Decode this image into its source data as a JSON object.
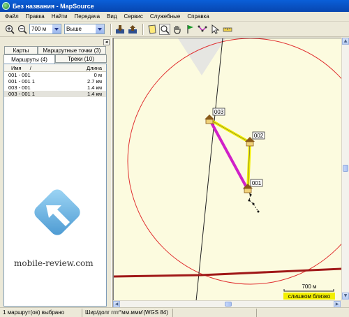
{
  "window": {
    "title": "Без названия - MapSource"
  },
  "menu": [
    "Файл",
    "Правка",
    "Найти",
    "Передача",
    "Вид",
    "Сервис",
    "Служебные",
    "Справка"
  ],
  "toolbar": {
    "zoom_value": "700 м",
    "detail_value": "Выше"
  },
  "left_panel": {
    "tabs_top": [
      "Карты",
      "Маршрутные точки (3)"
    ],
    "tabs_bottom": [
      "Маршруты (4)",
      "Треки (10)"
    ],
    "active_tab": "Маршруты (4)",
    "columns": {
      "name": "Имя",
      "length": "Длина",
      "sort_marker": "/"
    },
    "rows": [
      {
        "name": "001 - 001",
        "length": "0 м"
      },
      {
        "name": "001 - 001 1",
        "length": "2.7 км"
      },
      {
        "name": "003 - 001",
        "length": "1.4 км"
      },
      {
        "name": "003 - 001 1",
        "length": "1.4 км"
      }
    ],
    "selected_row": 3,
    "watermark": "mobile-review.com"
  },
  "map": {
    "waypoints": [
      "003",
      "002",
      "001"
    ],
    "scale_label": "700 м",
    "zoom_warning": "слишком близко",
    "colors": {
      "background": "#fcfbdf",
      "circle": "#e03030",
      "route_yellow": "#f2ee00",
      "route_magenta": "#d020c8",
      "road": "#a01818",
      "warning_bg": "#f2ee00"
    }
  },
  "status": {
    "selection": "1 маршрут(ов) выбрано",
    "coords": "Шир/долг гггг°мм.ммм'(WGS 84)"
  }
}
